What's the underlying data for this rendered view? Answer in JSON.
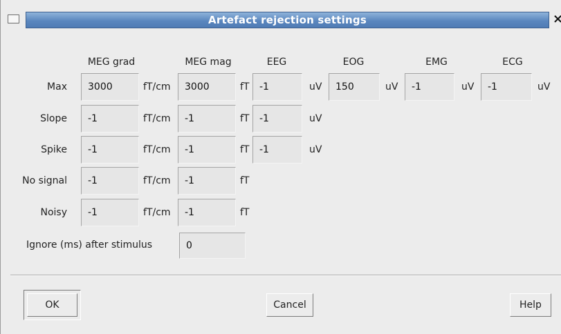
{
  "window": {
    "title": "Artefact rejection settings",
    "title_bar_color": "#5b87bf"
  },
  "columns": [
    {
      "label": "MEG grad",
      "unit": "fT/cm"
    },
    {
      "label": "MEG mag",
      "unit": "fT"
    },
    {
      "label": "EEG",
      "unit": "uV"
    },
    {
      "label": "EOG",
      "unit": "uV"
    },
    {
      "label": "EMG",
      "unit": "uV"
    },
    {
      "label": "ECG",
      "unit": "uV"
    }
  ],
  "rows": [
    {
      "label": "Max",
      "values": [
        "3000",
        "3000",
        "-1",
        "150",
        "-1",
        "-1"
      ],
      "units": [
        "fT/cm",
        "fT",
        "uV",
        "uV",
        "uV",
        "uV"
      ]
    },
    {
      "label": "Slope",
      "values": [
        "-1",
        "-1",
        "-1"
      ],
      "units": [
        "fT/cm",
        "fT",
        "uV"
      ]
    },
    {
      "label": "Spike",
      "values": [
        "-1",
        "-1",
        "-1"
      ],
      "units": [
        "fT/cm",
        "fT",
        "uV"
      ]
    },
    {
      "label": "No signal",
      "values": [
        "-1",
        "-1"
      ],
      "units": [
        "fT/cm",
        "fT"
      ]
    },
    {
      "label": "Noisy",
      "values": [
        "-1",
        "-1"
      ],
      "units": [
        "fT/cm",
        "fT"
      ]
    }
  ],
  "ignore": {
    "label": "Ignore (ms) after stimulus",
    "value": "0"
  },
  "buttons": {
    "ok": "OK",
    "cancel": "Cancel",
    "help": "Help"
  }
}
